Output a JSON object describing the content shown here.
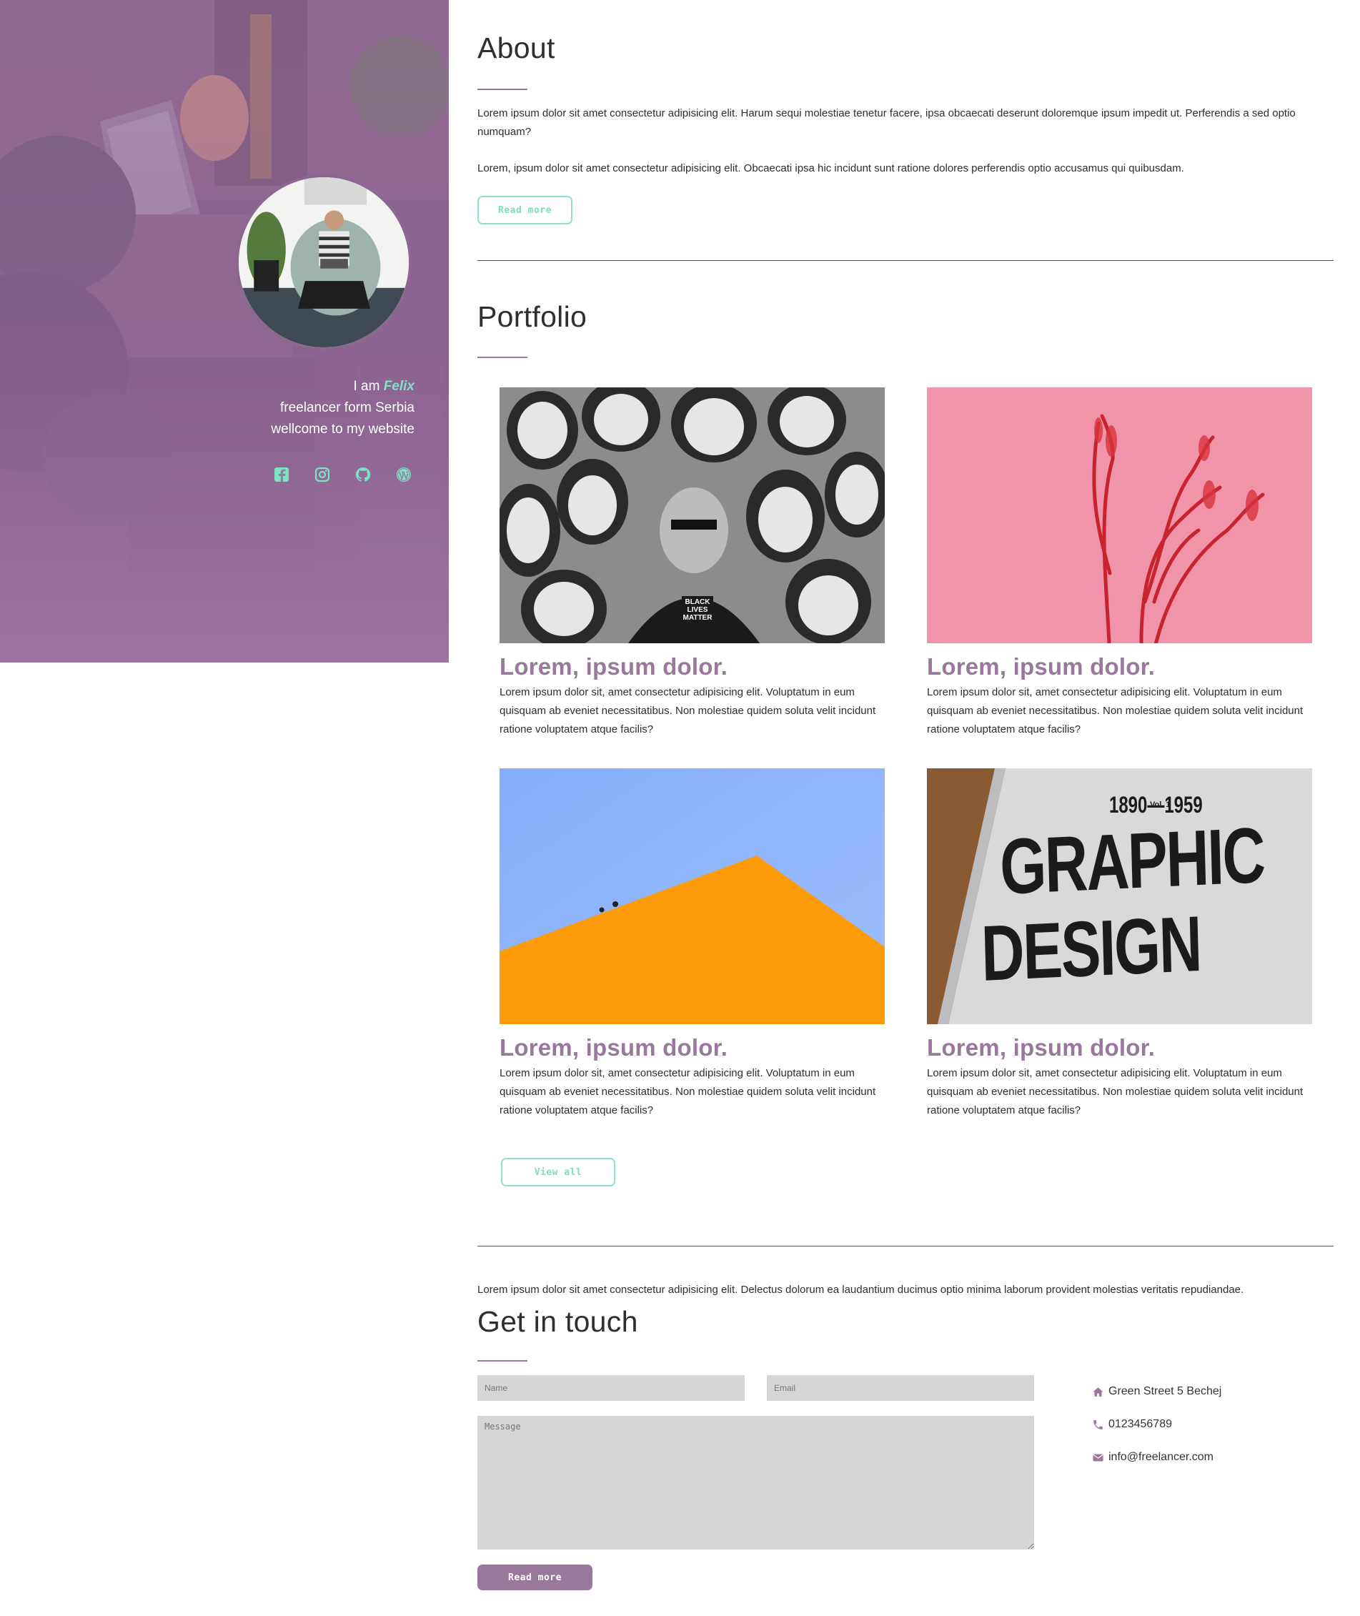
{
  "colors": {
    "accent_purple": "#9a789e",
    "accent_mint": "#7ddcbe",
    "field_gray": "#d6d6d6",
    "hero_overlay": "#8d6a92"
  },
  "hero": {
    "intro_prefix": "I am",
    "name": "Felix",
    "line2": "freelancer form Serbia",
    "line3": "wellcome to my website",
    "socials": [
      "facebook-icon",
      "instagram-icon",
      "github-icon",
      "wordpress-icon"
    ]
  },
  "about": {
    "heading": "About",
    "paragraph1": "Lorem ipsum dolor sit amet consectetur adipisicing elit. Harum sequi molestiae tenetur facere, ipsa obcaecati deserunt doloremque ipsum impedit ut. Perferendis a sed optio numquam?",
    "paragraph2": "Lorem, ipsum dolor sit amet consectetur adipisicing elit. Obcaecati ipsa hic incidunt sunt ratione dolores perferendis optio accusamus qui quibusdam.",
    "button_label": "Read more"
  },
  "portfolio": {
    "heading": "Portfolio",
    "items": [
      {
        "title": "Lorem, ipsum dolor.",
        "description": "Lorem ipsum dolor sit, amet consectetur adipisicing elit. Voluptatum in eum quisquam ab eveniet necessitatibus. Non molestiae quidem soluta velit incidunt ratione voluptatem atque facilis?",
        "image_text": "BLACK LIVES MATTER"
      },
      {
        "title": "Lorem, ipsum dolor.",
        "description": "Lorem ipsum dolor sit, amet consectetur adipisicing elit. Voluptatum in eum quisquam ab eveniet necessitatibus. Non molestiae quidem soluta velit incidunt ratione voluptatem atque facilis?"
      },
      {
        "title": "Lorem, ipsum dolor.",
        "description": "Lorem ipsum dolor sit, amet consectetur adipisicing elit. Voluptatum in eum quisquam ab eveniet necessitatibus. Non molestiae quidem soluta velit incidunt ratione voluptatem atque facilis?"
      },
      {
        "title": "Lorem, ipsum dolor.",
        "description": "Lorem ipsum dolor sit, amet consectetur adipisicing elit. Voluptatum in eum quisquam ab eveniet necessitatibus. Non molestiae quidem soluta velit incidunt ratione voluptatem atque facilis?",
        "image_text": {
          "vol": "Vol. 1",
          "years": "1890—1959",
          "line1": "GRAPHIC",
          "line2": "DESIGN"
        }
      }
    ],
    "button_label": "View all"
  },
  "contact": {
    "intro": "Lorem ipsum dolor sit amet consectetur adipisicing elit. Delectus dolorum ea laudantium ducimus optio minima laborum provident molestias veritatis repudiandae.",
    "heading": "Get in touch",
    "name_placeholder": "Name",
    "email_placeholder": "Email",
    "message_placeholder": "Message",
    "submit_label": "Read more",
    "address": "Green Street 5 Bechej",
    "phone": "0123456789",
    "email": "info@freelancer.com",
    "icons": [
      "home-icon",
      "phone-icon",
      "envelope-icon"
    ]
  }
}
